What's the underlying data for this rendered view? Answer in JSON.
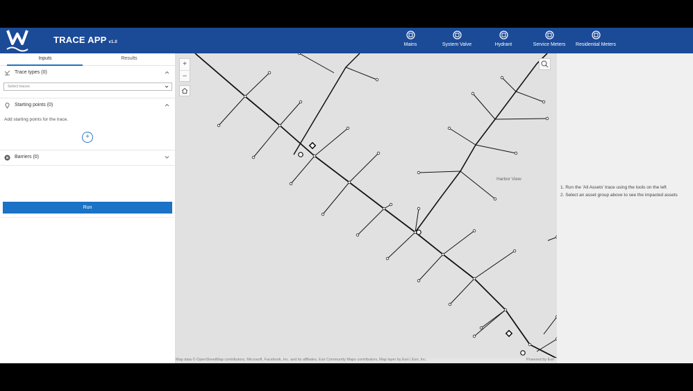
{
  "header": {
    "title": "TRACE APP",
    "version": "v1.0",
    "nav": [
      {
        "label": "Mains",
        "icon": "mains-icon"
      },
      {
        "label": "System Valve",
        "icon": "system-valve-icon"
      },
      {
        "label": "Hydrant",
        "icon": "hydrant-icon"
      },
      {
        "label": "Service Meters",
        "icon": "service-meters-icon"
      },
      {
        "label": "Residential Meters",
        "icon": "residential-meters-icon"
      }
    ]
  },
  "panel": {
    "tabs": [
      {
        "label": "Inputs",
        "active": true
      },
      {
        "label": "Results",
        "active": false
      }
    ],
    "trace_types": {
      "title": "Trace types (0)",
      "placeholder": "Select traces"
    },
    "starting_points": {
      "title": "Starting points (0)",
      "hint": "Add starting points for the trace.",
      "add_label": "+"
    },
    "barriers": {
      "title": "Barriers (0)"
    },
    "run_label": "Run"
  },
  "map": {
    "zoom_in": "+",
    "zoom_out": "–",
    "place_label": "Harbor View",
    "attribution": "Map data © OpenStreetMap contributors, Microsoft, Facebook, Inc. and its affiliates, Esri Community Maps contributors, Map layer by Esri | Esri, Inc.",
    "powered_by": "Powered by Esri"
  },
  "results": {
    "instructions": [
      "1. Run the 'All Assets' trace using the tools on the left",
      "2. Select an asset group above to see the impacted assets"
    ]
  },
  "colors": {
    "header": "#1b4a97",
    "accent": "#1a73c5",
    "map_bg": "#e1e1e1"
  }
}
